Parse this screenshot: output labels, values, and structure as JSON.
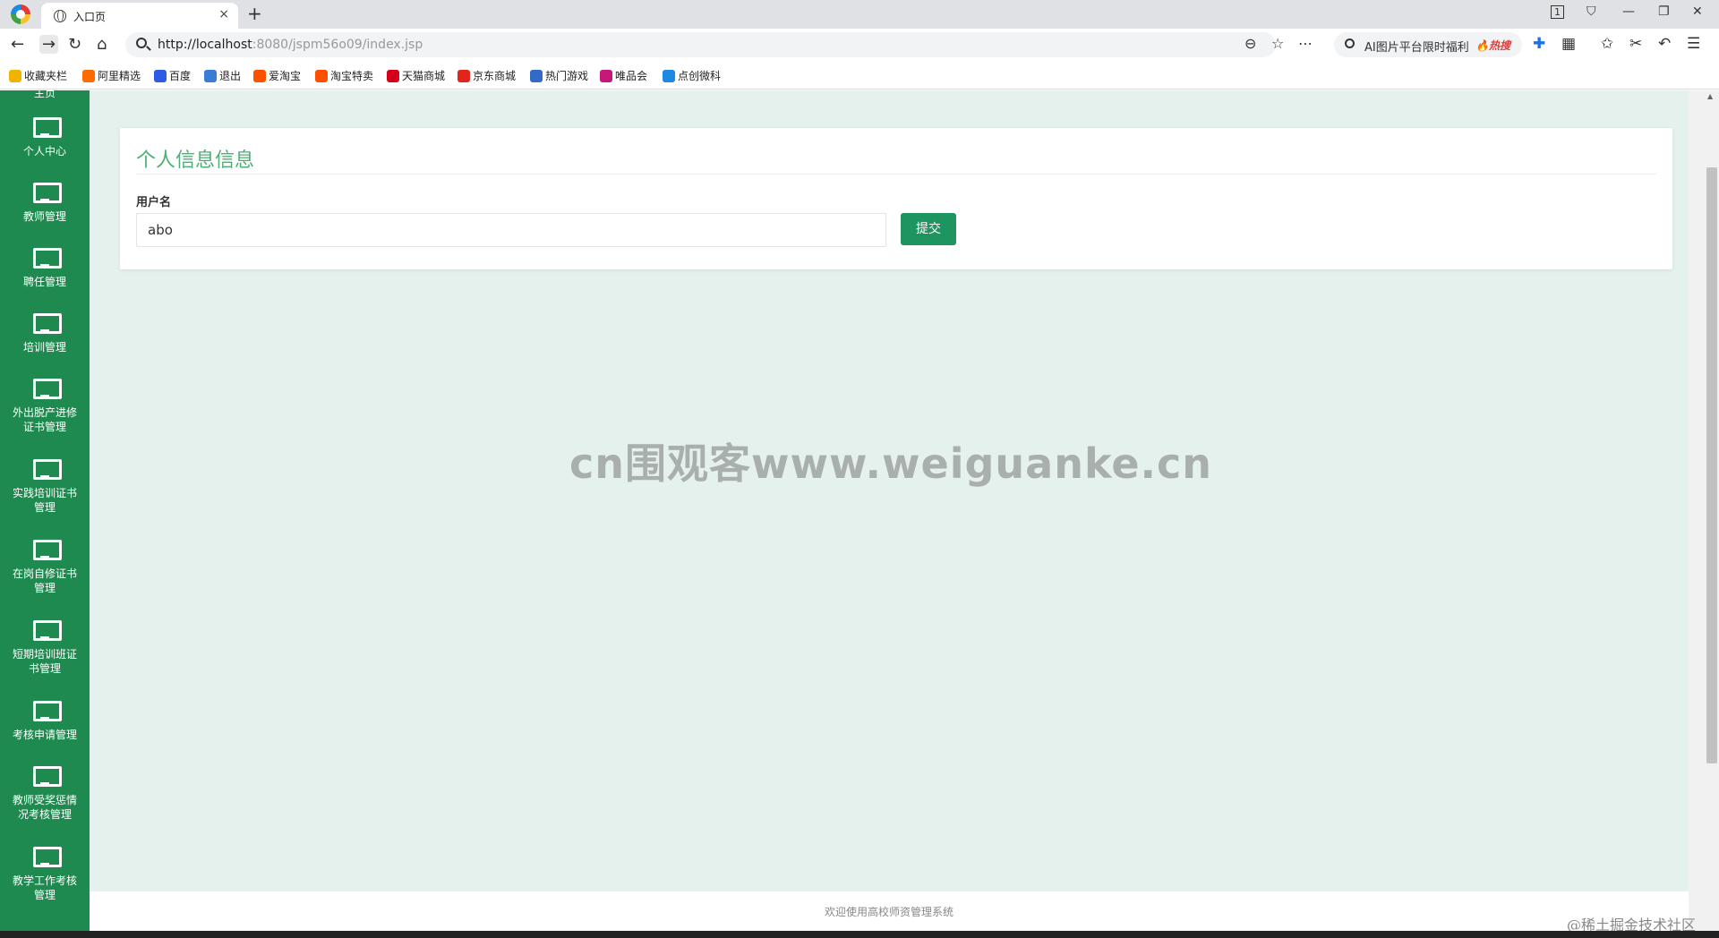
{
  "browser": {
    "tab_title": "入口页",
    "tab_close": "×",
    "new_tab": "+",
    "url_host": "http://localhost",
    "url_rest": ":8080/jspm56o09/index.jsp",
    "ai_search_label": "AI图片平台限时福利",
    "ai_search_hot": "🔥热搜",
    "window_controls": [
      "1",
      "⛉",
      "—",
      "❐",
      "✕"
    ],
    "bookmarks": [
      {
        "label": "收藏夹栏",
        "icon": "folder-icon",
        "color": "#f0b400"
      },
      {
        "label": "阿里精选",
        "icon": "ali-icon",
        "color": "#ff6a00"
      },
      {
        "label": "百度",
        "icon": "baidu-icon",
        "color": "#2d5be3"
      },
      {
        "label": "退出",
        "icon": "feather-icon",
        "color": "#3a7bd5"
      },
      {
        "label": "爱淘宝",
        "icon": "taobao-icon",
        "color": "#ff5000"
      },
      {
        "label": "淘宝特卖",
        "icon": "taobao-icon",
        "color": "#ff5000"
      },
      {
        "label": "天猫商城",
        "icon": "tmall-icon",
        "color": "#d4001a"
      },
      {
        "label": "京东商城",
        "icon": "jd-icon",
        "color": "#e1251b"
      },
      {
        "label": "热门游戏",
        "icon": "game-icon",
        "color": "#3569c8"
      },
      {
        "label": "唯品会",
        "icon": "vip-icon",
        "color": "#c6177a"
      },
      {
        "label": "点创微科",
        "icon": "dc-icon",
        "color": "#1e88e5"
      }
    ]
  },
  "sidebar": {
    "cut_label": "主页",
    "items": [
      {
        "label": "个人中心"
      },
      {
        "label": "教师管理"
      },
      {
        "label": "聘任管理"
      },
      {
        "label": "培训管理"
      },
      {
        "label": "外出脱产进修证书管理"
      },
      {
        "label": "实践培训证书管理"
      },
      {
        "label": "在岗自修证书管理"
      },
      {
        "label": "短期培训班证书管理"
      },
      {
        "label": "考核申请管理"
      },
      {
        "label": "教师受奖惩情况考核管理"
      },
      {
        "label": "教学工作考核管理"
      }
    ]
  },
  "form": {
    "title": "个人信息信息",
    "username_label": "用户名",
    "username_value": "abo",
    "submit_label": "提交"
  },
  "watermark": "cn围观客www.weiguanke.cn",
  "footer": "欢迎使用高校师资管理系统",
  "credit": "@稀土掘金技术社区"
}
